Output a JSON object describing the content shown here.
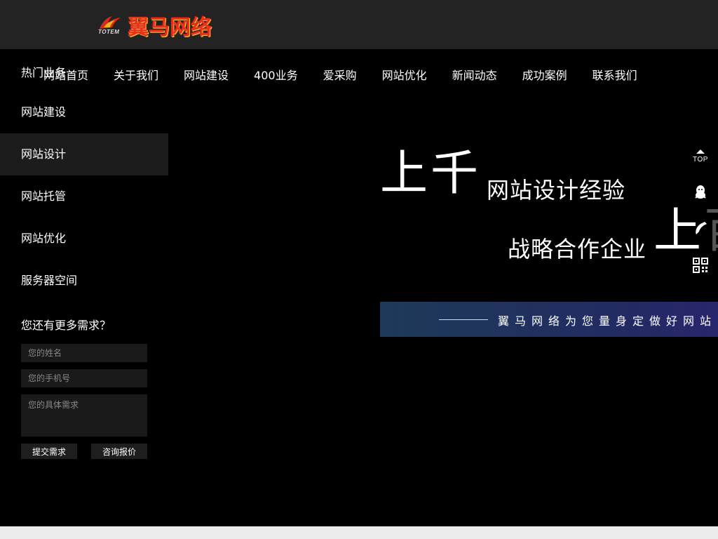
{
  "header": {
    "logo_sub": "TOTEM",
    "logo_text": "翼马网络"
  },
  "nav": {
    "items": [
      "网站首页",
      "关于我们",
      "网站建设",
      "400业务",
      "爱采购",
      "网站优化",
      "新闻动态",
      "成功案例",
      "联系我们"
    ]
  },
  "sidebar": {
    "heading": "热门业务",
    "items": [
      {
        "label": "网站建设",
        "active": false
      },
      {
        "label": "网站设计",
        "active": true
      },
      {
        "label": "网站托管",
        "active": false
      },
      {
        "label": "网站优化",
        "active": false
      },
      {
        "label": "服务器空间",
        "active": false
      }
    ]
  },
  "form": {
    "title": "您还有更多需求？",
    "name_placeholder": "您的姓名",
    "phone_placeholder": "您的手机号",
    "needs_placeholder": "您的具体需求",
    "submit_label": "提交需求",
    "quote_label": "咨询报价"
  },
  "hero": {
    "big1": "上千",
    "small1": "网站设计经验",
    "small2": "战略合作企业",
    "big2": "上",
    "big2_ghost": "百",
    "banner_text": "翼马网络为您量身定做好网站"
  },
  "float_bar": {
    "top_label": "TOP",
    "icons": [
      "qq-icon",
      "phone-icon",
      "qrcode-icon"
    ]
  },
  "colors": {
    "page_bg": "#000000",
    "topbar_bg": "#232323",
    "sidebar_active_bg": "#1c1c1c",
    "banner_start": "#1d3a58",
    "banner_end": "#2a2470",
    "logo_red": "#e8311a"
  }
}
